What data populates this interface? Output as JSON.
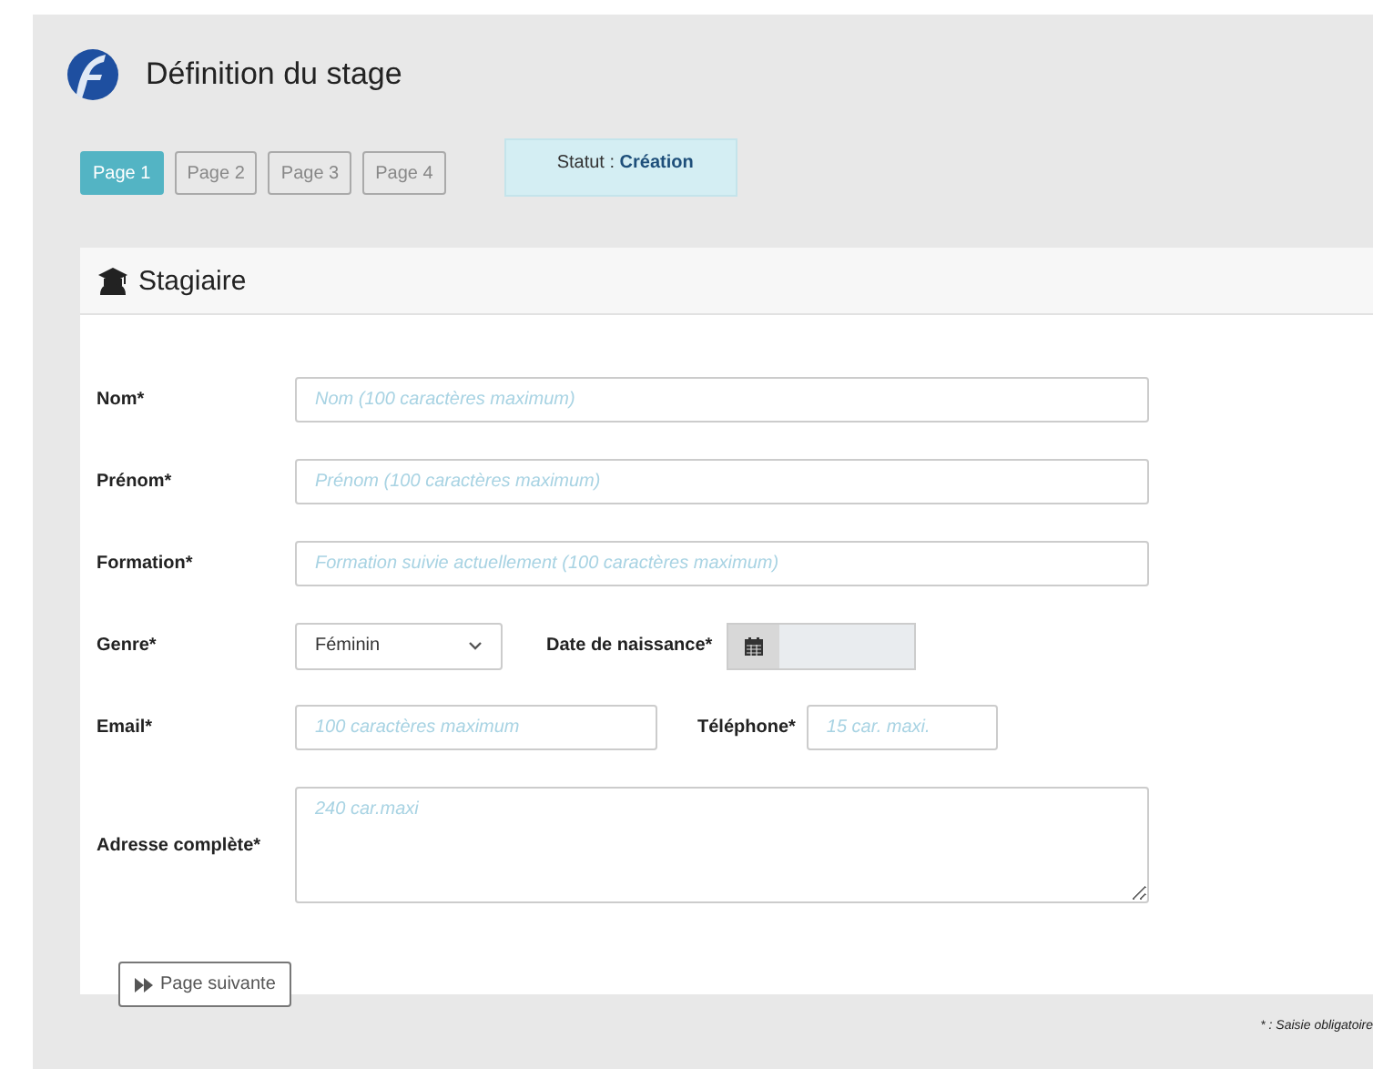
{
  "header": {
    "title": "Définition du stage"
  },
  "tabs": [
    {
      "label": "Page 1",
      "selected": true
    },
    {
      "label": "Page 2",
      "selected": false
    },
    {
      "label": "Page 3",
      "selected": false
    },
    {
      "label": "Page 4",
      "selected": false
    }
  ],
  "status": "Statut : **Création**",
  "section": {
    "title": "Stagiaire"
  },
  "rows": [
    {
      "fields": [
        {
          "kind": "text",
          "label": "Nom*",
          "placeholder": "Nom (100 caractères maximum)"
        }
      ]
    },
    {
      "fields": [
        {
          "kind": "text",
          "label": "Prénom*",
          "placeholder": "Prénom (100 caractères maximum)"
        }
      ]
    },
    {
      "fields": [
        {
          "kind": "text",
          "label": "Formation*",
          "placeholder": "Formation suivie actuellement (100 caractères maximum)"
        }
      ]
    },
    {
      "fields": [
        {
          "kind": "select",
          "label": "Genre*",
          "value": "Féminin"
        },
        {
          "kind": "date",
          "label": "Date de naissance*"
        }
      ]
    },
    {
      "fields": [
        {
          "kind": "short",
          "label": "Email*",
          "placeholder": "100 caractères maximum"
        },
        {
          "kind": "tiny",
          "label": "Téléphone*",
          "placeholder": "15 car. maxi."
        }
      ]
    },
    {
      "fields": [
        {
          "kind": "textarea",
          "label": "Adresse complète*",
          "placeholder": "240 car.maxi"
        }
      ]
    }
  ],
  "next_button": "Page suivante",
  "footnote": "* : Saisie obligatoire"
}
